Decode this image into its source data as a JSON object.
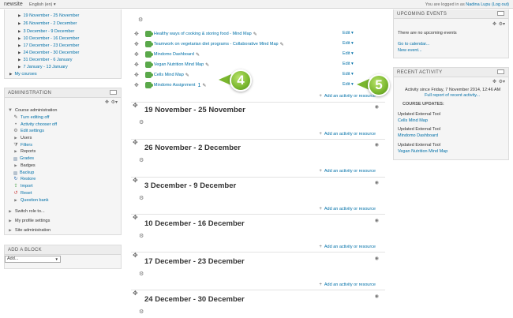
{
  "topbar": {
    "brand": "newsite",
    "language": "English (en) ▾",
    "login_prefix": "You are logged in as",
    "username": "Nadina Lupu",
    "logout": "(Log out)"
  },
  "nav": {
    "weeks": [
      "19 November - 25 November",
      "26 November - 2 December",
      "3 December - 9 December",
      "10 December - 16 December",
      "17 December - 23 December",
      "24 December - 30 December",
      "31 December - 6 January",
      "7 January - 13 January"
    ],
    "my_courses": "My courses"
  },
  "admin": {
    "title": "ADMINISTRATION",
    "course_admin": "Course administration",
    "items": [
      "Turn editing off",
      "Activity chooser off",
      "Edit settings",
      "Users",
      "Filters",
      "Reports",
      "Grades",
      "Badges",
      "Backup",
      "Restore",
      "Import",
      "Reset",
      "Question bank"
    ],
    "switch_role": "Switch role to...",
    "profile_settings": "My profile settings",
    "site_admin": "Site administration"
  },
  "add_block": {
    "title": "ADD A BLOCK",
    "select_value": "Add..."
  },
  "activities": [
    {
      "name": "Healthy ways of cooking & storing food - Mind Map"
    },
    {
      "name": "Teamwork on vegetarian diet programs - Collaborative Mind Map"
    },
    {
      "name": "Mindomo Dashboard"
    },
    {
      "name": "Vegan Nutrition Mind Map"
    },
    {
      "name": "Cells Mind Map"
    },
    {
      "name": "Mindomo Assignment"
    }
  ],
  "edit_label": "Edit ▾",
  "add_activity_label": "Add an activity or resource",
  "sections": [
    "19 November - 25 November",
    "26 November - 2 December",
    "3 December - 9 December",
    "10 December - 16 December",
    "17 December - 23 December",
    "24 December - 30 December"
  ],
  "callouts": [
    "4",
    "5"
  ],
  "upcoming": {
    "title": "UPCOMING EVENTS",
    "empty": "There are no upcoming events",
    "go_calendar": "Go to calendar...",
    "new_event": "New event..."
  },
  "recent": {
    "title": "RECENT ACTIVITY",
    "since": "Activity since Friday, 7 November 2014, 12:46 AM",
    "full_report": "Full report of recent activity...",
    "course_updates": "COURSE UPDATES:",
    "updates": [
      {
        "action": "Updated External Tool",
        "item": "Cells Mind Map"
      },
      {
        "action": "Updated External Tool",
        "item": "Mindomo Dashboard"
      },
      {
        "action": "Updated External Tool",
        "item": "Vegan Nutrition Mind Map"
      }
    ]
  }
}
